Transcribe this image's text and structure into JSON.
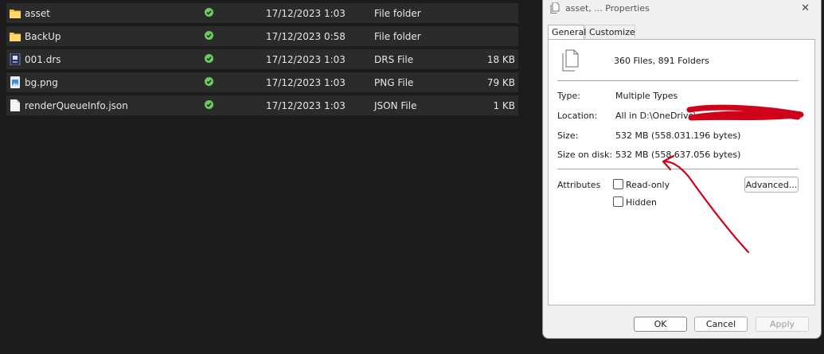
{
  "files": [
    {
      "icon": "folder-icon",
      "name": "asset",
      "date": "17/12/2023 1:03",
      "type": "File folder",
      "size": ""
    },
    {
      "icon": "folder-icon",
      "name": "BackUp",
      "date": "17/12/2023 0:58",
      "type": "File folder",
      "size": ""
    },
    {
      "icon": "drs-file-icon",
      "name": "001.drs",
      "date": "17/12/2023 1:03",
      "type": "DRS File",
      "size": "18 KB"
    },
    {
      "icon": "image-file-icon",
      "name": "bg.png",
      "date": "17/12/2023 1:03",
      "type": "PNG File",
      "size": "79 KB"
    },
    {
      "icon": "document-file-icon",
      "name": "renderQueueInfo.json",
      "date": "17/12/2023 1:03",
      "type": "JSON File",
      "size": "1 KB"
    }
  ],
  "dialog": {
    "title": "asset, ... Properties",
    "close": "✕",
    "tabs": [
      "General",
      "Customize"
    ],
    "summary": "360 Files, 891 Folders",
    "type_label": "Type:",
    "type_value": "Multiple Types",
    "location_label": "Location:",
    "location_value": "All in D:\\OneDrive\\",
    "size_label": "Size:",
    "size_value": "532 MB (558.031.196 bytes)",
    "size_on_disk_label": "Size on disk:",
    "size_on_disk_value": "532 MB (558.637.056 bytes)",
    "attributes_label": "Attributes",
    "readonly_label": "Read-only",
    "hidden_label": "Hidden",
    "advanced_label": "Advanced...",
    "ok_label": "OK",
    "cancel_label": "Cancel",
    "apply_label": "Apply"
  },
  "colors": {
    "explorer_background": "#1c1c1c",
    "row_background": "#2b2b2b",
    "folder": "#f5c84c",
    "sync_ok": "#6ccb5f",
    "annotation": "#d0021b"
  }
}
